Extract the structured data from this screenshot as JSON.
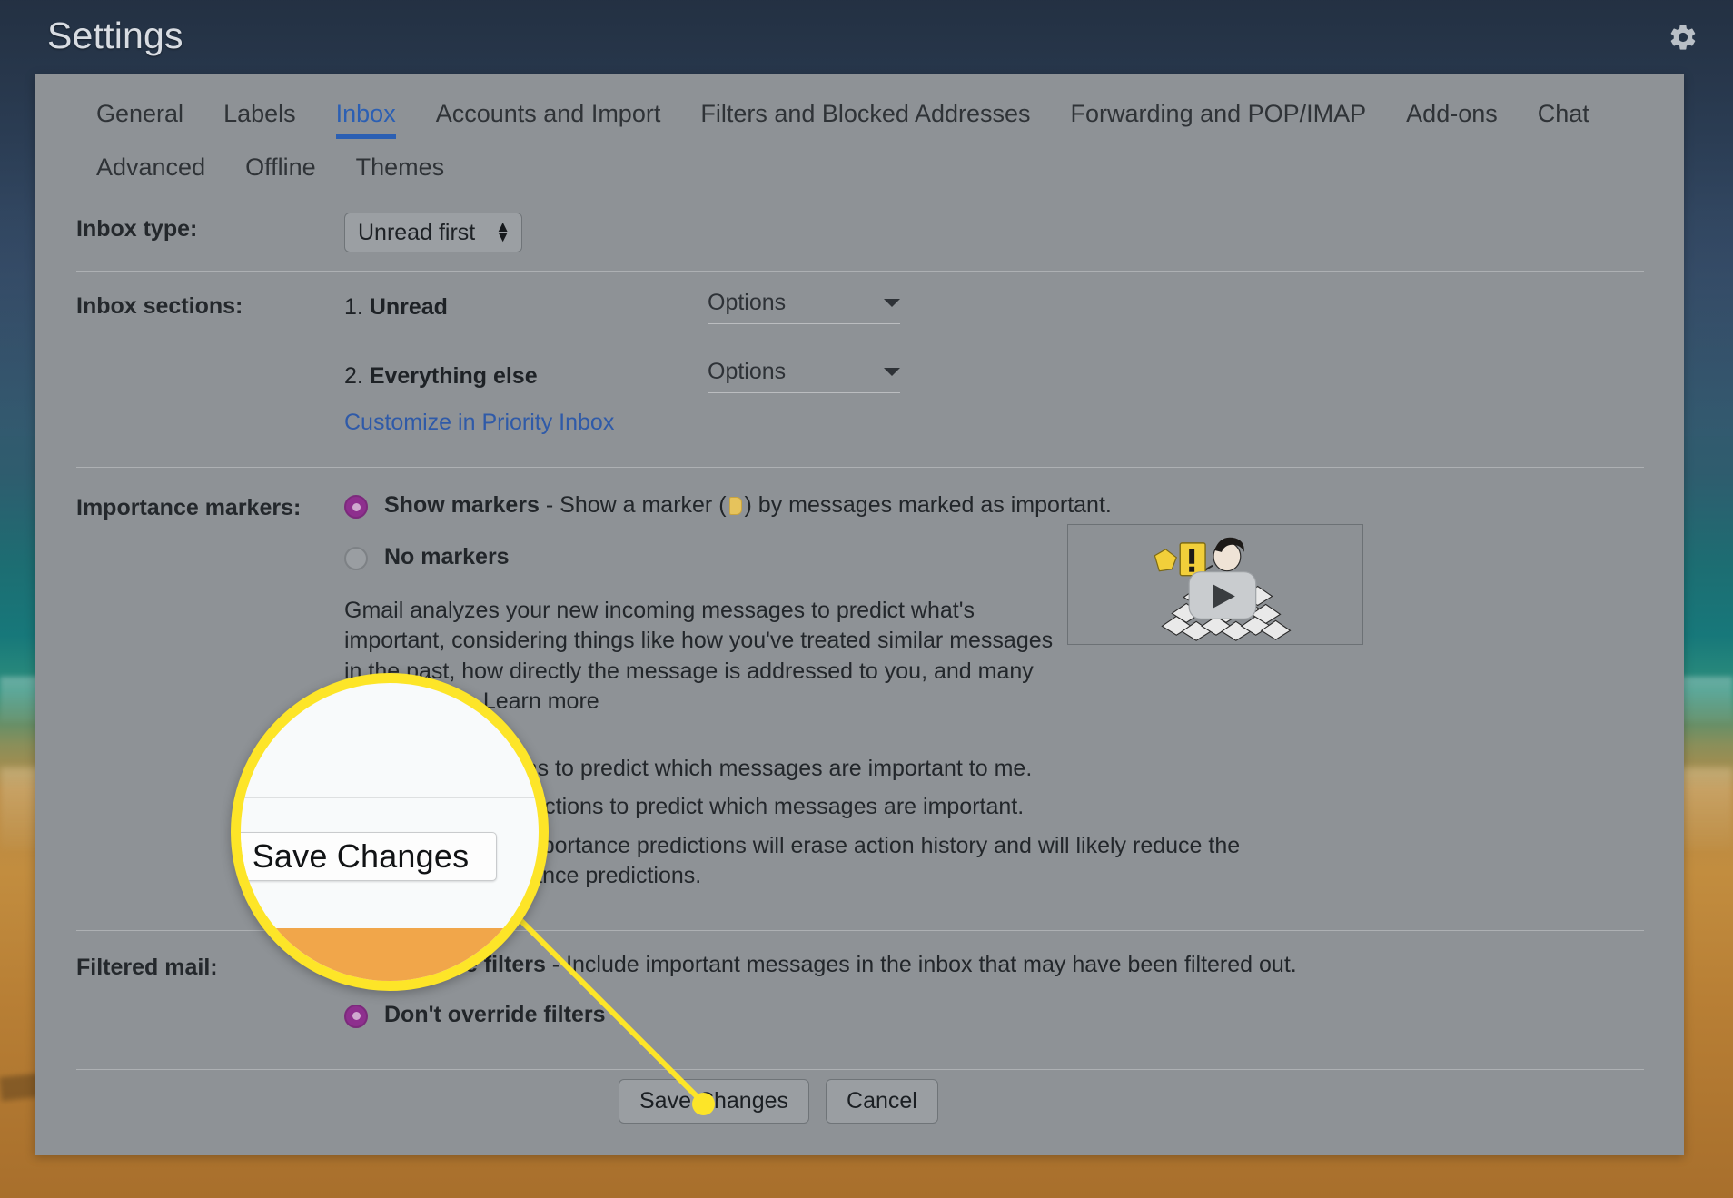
{
  "header": {
    "title": "Settings",
    "gear_icon": "gear-icon"
  },
  "tabs": {
    "row1": [
      {
        "label": "General",
        "active": false
      },
      {
        "label": "Labels",
        "active": false
      },
      {
        "label": "Inbox",
        "active": true
      },
      {
        "label": "Accounts and Import",
        "active": false
      },
      {
        "label": "Filters and Blocked Addresses",
        "active": false
      },
      {
        "label": "Forwarding and POP/IMAP",
        "active": false
      },
      {
        "label": "Add-ons",
        "active": false
      },
      {
        "label": "Chat",
        "active": false
      }
    ],
    "row2": [
      {
        "label": "Advanced",
        "active": false
      },
      {
        "label": "Offline",
        "active": false
      },
      {
        "label": "Themes",
        "active": false
      }
    ]
  },
  "settings": {
    "inbox_type": {
      "label": "Inbox type:",
      "value": "Unread first"
    },
    "inbox_sections": {
      "label": "Inbox sections:",
      "items": [
        {
          "index": "1.",
          "name": "Unread",
          "options_label": "Options"
        },
        {
          "index": "2.",
          "name": "Everything else",
          "options_label": "Options"
        }
      ],
      "customize_link": "Customize in Priority Inbox"
    },
    "importance_markers": {
      "label": "Importance markers:",
      "show_markers_bold": "Show markers",
      "show_markers_rest_a": " - Show a marker (",
      "show_markers_rest_b": ") by messages marked as important.",
      "no_markers": "No markers",
      "show_markers_selected": true,
      "paragraph": "Gmail analyzes your new incoming messages to predict what's important, considering things like how you've treated similar messages in the past, how directly the message is addressed to you, and many other factors. Learn more",
      "learn_more": "Learn more",
      "use_past_actions": "Use my past actions to predict which messages are important to me.",
      "dont_use_past_actions": "Don't use my past actions to predict which messages are important.",
      "reset_note": "Note: Turning off importance predictions will erase action history and will likely reduce the accuracy of importance predictions."
    },
    "filtered_mail": {
      "label": "Filtered mail:",
      "override_bold": "Override filters",
      "override_rest": " - Include important messages in the inbox that may have been filtered out.",
      "dont_override": "Don't override filters",
      "dont_override_selected": true
    },
    "buttons": {
      "save": "Save Changes",
      "cancel": "Cancel"
    }
  },
  "callout": {
    "zoom_button_label": "Save Changes",
    "ring_color": "#fde528",
    "orange_band_color": "#f1a64a"
  },
  "video": {
    "play_icon": "play-button-icon",
    "alt_name": "priority-inbox-video-thumbnail"
  },
  "colors": {
    "panel_bg": "#8e9296",
    "accent_blue": "#2b5fb3",
    "link_blue": "#2f5aa8",
    "radio_selected": "#8e2f8e",
    "highlight_yellow": "#fde528"
  }
}
